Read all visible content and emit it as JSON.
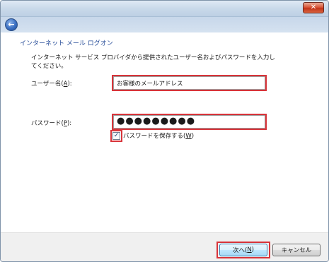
{
  "window": {
    "close_glyph": "✕",
    "back_glyph": "←"
  },
  "page": {
    "title": "インターネット メール ログオン",
    "instruction": "インターネット サービス プロバイダから提供されたユーザー名およびパスワードを入力してください。"
  },
  "username": {
    "label_prefix": "ユーザー名(",
    "label_accel": "A",
    "label_suffix": "):",
    "value": "お客様のメールアドレス"
  },
  "password": {
    "label_prefix": "パスワード(",
    "label_accel": "P",
    "label_suffix": "):",
    "value": "●●●●●●●●●"
  },
  "remember": {
    "checked_glyph": "✓",
    "label_prefix": "パスワードを保存する(",
    "label_accel": "W",
    "label_suffix": ")"
  },
  "footer": {
    "next_prefix": "次へ(",
    "next_accel": "N",
    "next_suffix": ")",
    "cancel_label": "キャンセル"
  },
  "colors": {
    "highlight": "#d8343a",
    "title_text": "#2a4f9a"
  },
  "icons": [
    "close-icon",
    "back-arrow-icon",
    "checkmark-icon"
  ]
}
